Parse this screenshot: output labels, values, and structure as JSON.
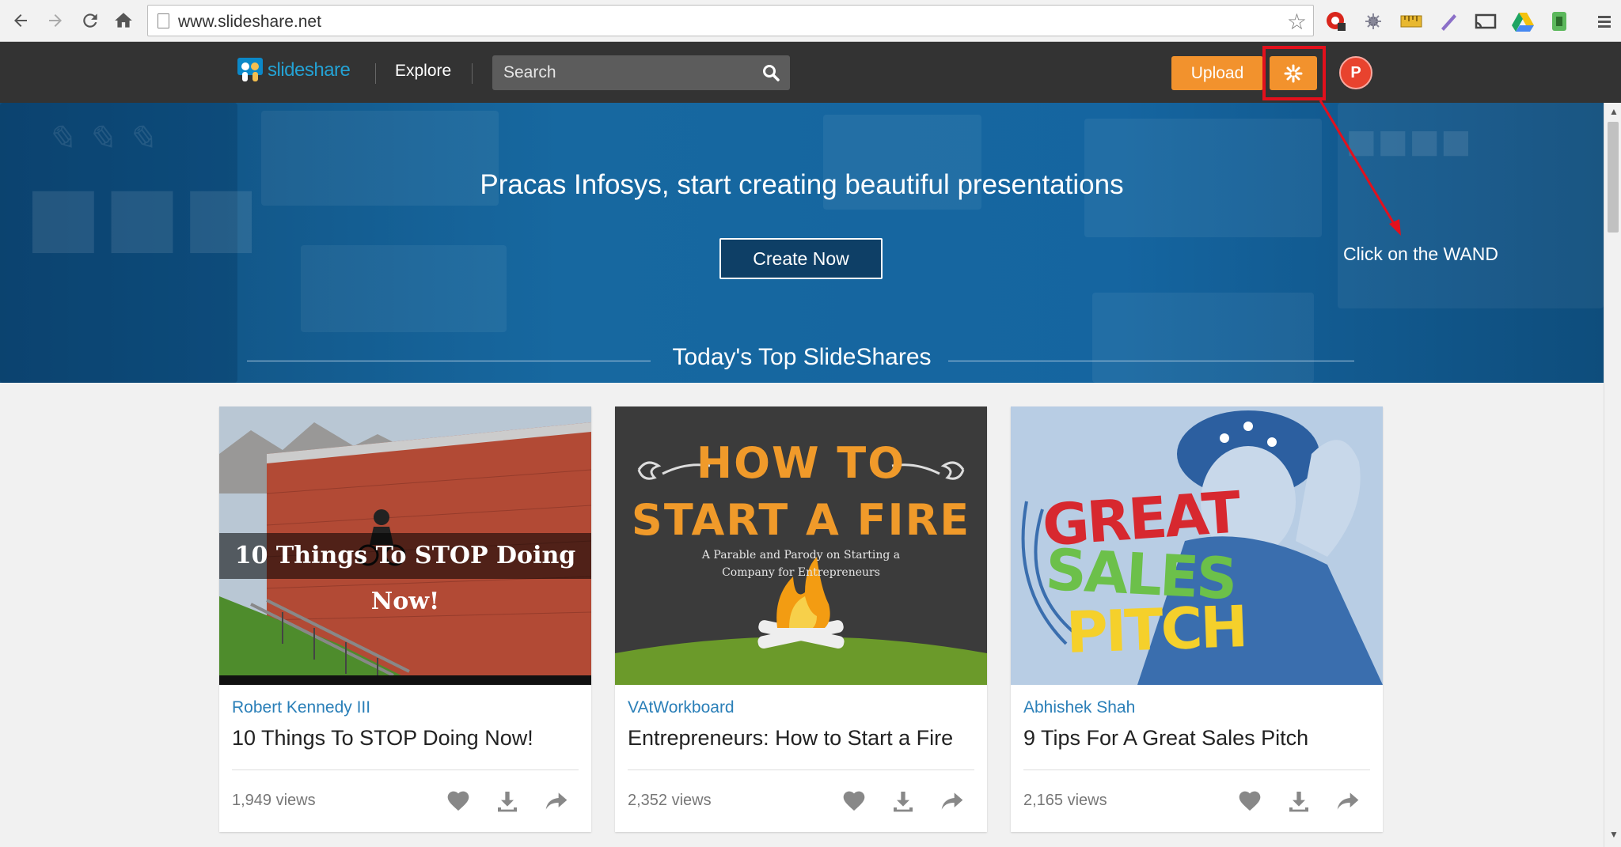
{
  "browser": {
    "url": "www.slideshare.net",
    "back_icon": "back-arrow-icon",
    "forward_icon": "forward-arrow-icon",
    "reload_icon": "reload-icon",
    "home_icon": "home-icon"
  },
  "header": {
    "logo_text": "slideshare",
    "explore_label": "Explore",
    "search_placeholder": "Search",
    "upload_label": "Upload",
    "avatar_letter": "P"
  },
  "hero": {
    "title": "Pracas Infosys, start creating beautiful presentations",
    "create_label": "Create Now",
    "section_title": "Today's Top SlideShares"
  },
  "annotation": {
    "note": "Click on the WAND",
    "color": "#e3101c"
  },
  "cards": [
    {
      "author": "Robert Kennedy III",
      "title": "10 Things To STOP Doing Now!",
      "views": "1,949 views",
      "thumb_text": "10 Things To STOP Doing Now!"
    },
    {
      "author": "VAtWorkboard",
      "title": "Entrepreneurs: How to Start a Fire",
      "views": "2,352 views",
      "thumb_line1": "HOW TO",
      "thumb_line2": "START A FIRE",
      "thumb_sub1": "A Parable and Parody on Starting a",
      "thumb_sub2": "Company for Entrepreneurs"
    },
    {
      "author": "Abhishek Shah",
      "title": "9 Tips For A Great Sales Pitch",
      "views": "2,165 views",
      "thumb_line1": "GREAT",
      "thumb_line2": "SALES",
      "thumb_line3": "PITCH"
    }
  ],
  "colors": {
    "accent_orange": "#f2922d",
    "header_bg": "#333333",
    "link_blue": "#2a7fb8"
  }
}
